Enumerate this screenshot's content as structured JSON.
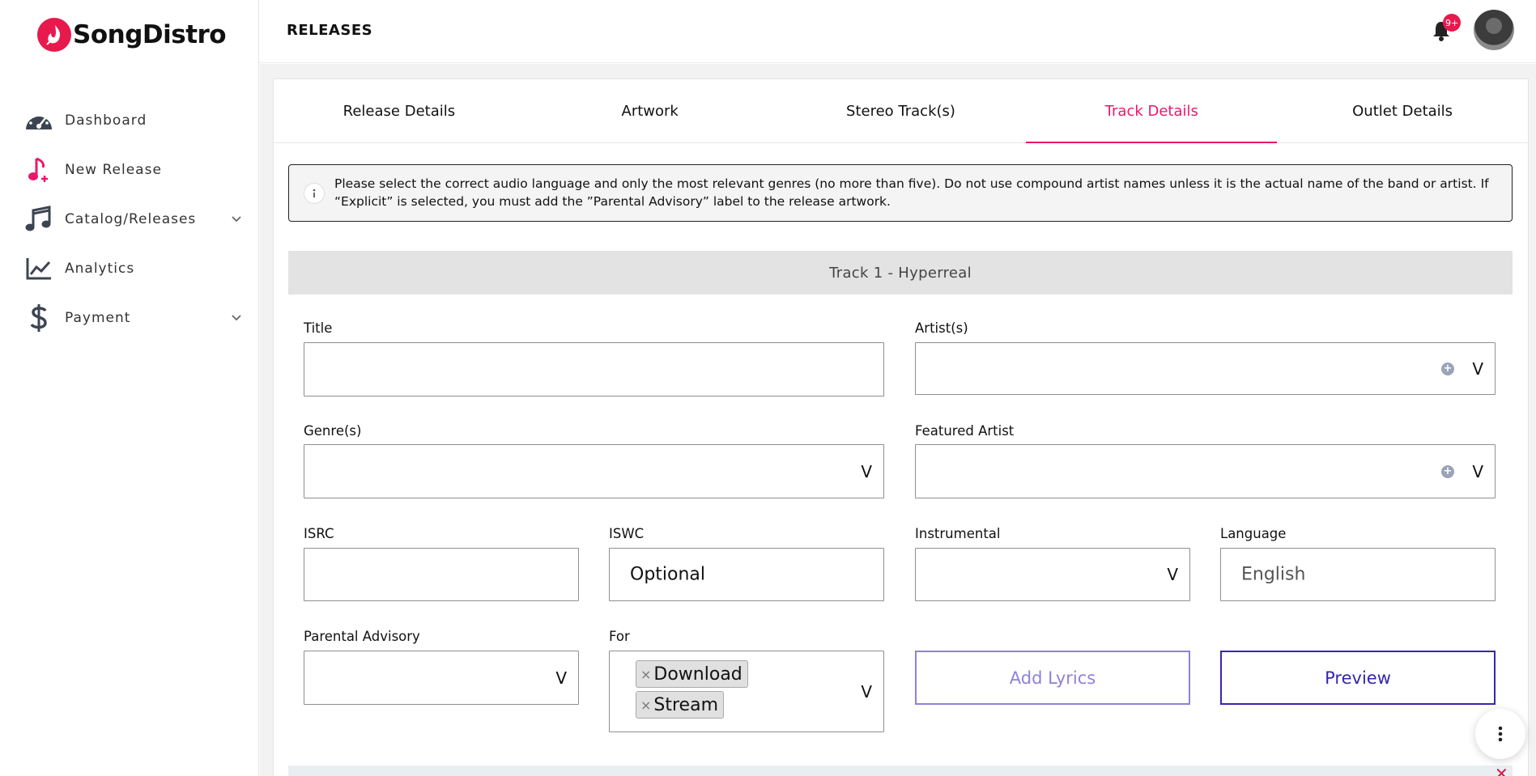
{
  "brand": {
    "name": "SongDistro",
    "accent": "#e8194d"
  },
  "header": {
    "title": "RELEASES",
    "notifications_badge": "9+"
  },
  "sidebar": {
    "items": [
      {
        "label": "Dashboard",
        "icon": "gauge-icon"
      },
      {
        "label": "New Release",
        "icon": "music-note-plus-icon"
      },
      {
        "label": "Catalog/Releases",
        "icon": "music-notes-icon",
        "expandable": true
      },
      {
        "label": "Analytics",
        "icon": "chart-line-icon"
      },
      {
        "label": "Payment",
        "icon": "dollar-icon",
        "expandable": true
      }
    ]
  },
  "tabs": [
    {
      "label": "Release Details"
    },
    {
      "label": "Artwork"
    },
    {
      "label": "Stereo Track(s)"
    },
    {
      "label": "Track Details",
      "active": true
    },
    {
      "label": "Outlet Details"
    }
  ],
  "notice": {
    "text": "Please select the correct audio language and only the most relevant genres (no more than five). Do not use compound artist names unless it is the actual name of the band or artist. If “Explicit” is selected, you must add the ”Parental Advisory” label to the release artwork."
  },
  "track": {
    "header": "Track 1 - Hyperreal"
  },
  "form": {
    "title": {
      "label": "Title",
      "value": ""
    },
    "artists": {
      "label": "Artist(s)",
      "value": ""
    },
    "genres": {
      "label": "Genre(s)",
      "value": ""
    },
    "featured_artist": {
      "label": "Featured Artist",
      "value": ""
    },
    "isrc": {
      "label": "ISRC",
      "value": ""
    },
    "iswc": {
      "label": "ISWC",
      "placeholder": "Optional"
    },
    "instrumental": {
      "label": "Instrumental",
      "value": ""
    },
    "language": {
      "label": "Language",
      "value": "English"
    },
    "parental_advisory": {
      "label": "Parental Advisory",
      "value": ""
    },
    "for": {
      "label": "For",
      "selected": [
        "Download",
        "Stream"
      ]
    },
    "caret_glyph": "V"
  },
  "buttons": {
    "add_lyrics": "Add Lyrics",
    "preview": "Preview"
  }
}
